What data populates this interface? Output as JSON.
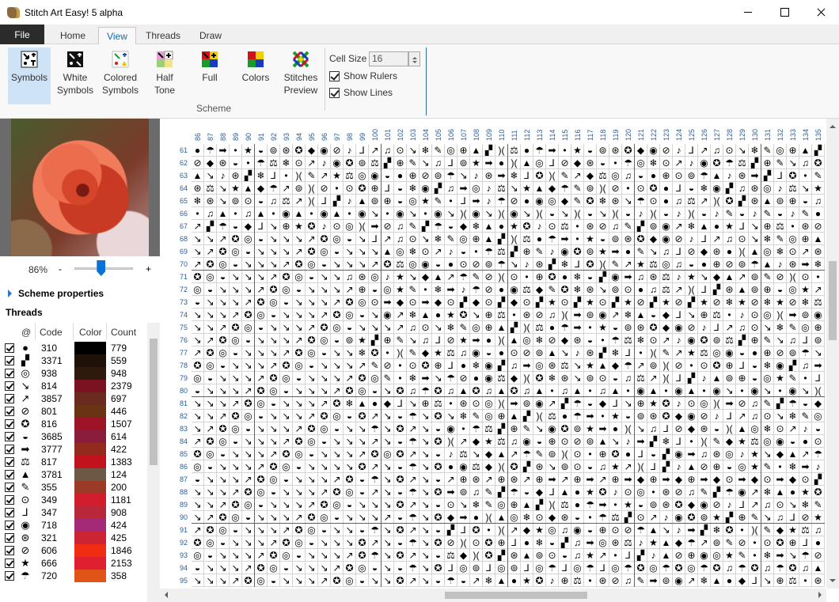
{
  "window": {
    "title": "Stitch Art Easy! 5 alpha"
  },
  "ribbon": {
    "tabs": [
      "File",
      "Home",
      "View",
      "Threads",
      "Draw"
    ],
    "active_tab": "View",
    "buttons": {
      "symbols": "Symbols",
      "white_symbols": "White Symbols",
      "colored_symbols": "Colored Symbols",
      "half_tone": "Half Tone",
      "full": "Full",
      "colors": "Colors",
      "stitches_preview": "Stitches Preview"
    },
    "group_label": "Scheme",
    "cell_size_label": "Cell Size",
    "cell_size_value": "16",
    "show_rulers": "Show Rulers",
    "show_lines": "Show Lines"
  },
  "left_panel": {
    "zoom_value": "86%",
    "zoom_fraction": 0.45,
    "zoom_minus": "-",
    "zoom_plus": "+",
    "scheme_properties": "Scheme properties",
    "threads_label": "Threads",
    "columns": {
      "symbol": "@",
      "code": "Code",
      "color": "Color",
      "count": "Count"
    },
    "threads": [
      {
        "symbol": "●",
        "code": "310",
        "color": "#000000",
        "count": "779"
      },
      {
        "symbol": "▞",
        "code": "3371",
        "color": "#1e1208",
        "count": "559"
      },
      {
        "symbol": "◎",
        "code": "938",
        "color": "#2e1a0c",
        "count": "948"
      },
      {
        "symbol": "↘",
        "code": "814",
        "color": "#7a1222",
        "count": "2379"
      },
      {
        "symbol": "↗",
        "code": "3857",
        "color": "#6a2a20",
        "count": "697"
      },
      {
        "symbol": "⊘",
        "code": "801",
        "color": "#6a3414",
        "count": "446"
      },
      {
        "symbol": "✪",
        "code": "816",
        "color": "#9c1426",
        "count": "1507"
      },
      {
        "symbol": "◒",
        "code": "3685",
        "color": "#8a1c3c",
        "count": "614"
      },
      {
        "symbol": "➡",
        "code": "3777",
        "color": "#922a1e",
        "count": "422"
      },
      {
        "symbol": "⚖",
        "code": "817",
        "color": "#c2121e",
        "count": "1383"
      },
      {
        "symbol": "▲",
        "code": "3781",
        "color": "#6c5844",
        "count": "124"
      },
      {
        "symbol": "✎",
        "code": "355",
        "color": "#9c3a28",
        "count": "200"
      },
      {
        "symbol": "⊙",
        "code": "349",
        "color": "#d21e2c",
        "count": "1181"
      },
      {
        "symbol": "⅃",
        "code": "347",
        "color": "#b8283a",
        "count": "908"
      },
      {
        "symbol": "◉",
        "code": "718",
        "color": "#a42a78",
        "count": "424"
      },
      {
        "symbol": "⊛",
        "code": "321",
        "color": "#cc2432",
        "count": "425"
      },
      {
        "symbol": "⊘",
        "code": "606",
        "color": "#f02c12",
        "count": "1846"
      },
      {
        "symbol": "★",
        "code": "666",
        "color": "#e02030",
        "count": "2153"
      },
      {
        "symbol": "☂",
        "code": "720",
        "color": "#e05418",
        "count": "358"
      }
    ]
  },
  "grid": {
    "col_labels": [
      "86",
      "87",
      "88",
      "89",
      "90",
      "91",
      "92",
      "93",
      "94",
      "95",
      "96",
      "97",
      "98",
      "99",
      "100",
      "101",
      "102",
      "103",
      "104",
      "105",
      "106",
      "107",
      "108",
      "109",
      "110",
      "111",
      "112",
      "113",
      "114",
      "115",
      "116",
      "117",
      "118",
      "119",
      "120",
      "121",
      "122",
      "123",
      "124",
      "125",
      "126",
      "127",
      "128",
      "129",
      "130",
      "131",
      "132",
      "133",
      "134",
      "135"
    ],
    "row_labels": [
      "61",
      "62",
      "63",
      "64",
      "65",
      "66",
      "67",
      "68",
      "69",
      "70",
      "71",
      "72",
      "73",
      "74",
      "75",
      "76",
      "77",
      "78",
      "79",
      "80",
      "81",
      "82",
      "83",
      "84",
      "85",
      "86",
      "87",
      "88",
      "89",
      "90",
      "91",
      "92",
      "93",
      "94",
      "95"
    ],
    "symbols": [
      "●",
      "▞",
      "◎",
      "↘",
      "↗",
      "⊘",
      "✪",
      "◒",
      "➡",
      "⚖",
      "▲",
      "✎",
      "⊙",
      "⅃",
      "◉",
      "⊛",
      "★",
      "☂",
      ")(",
      "⊕",
      "❄",
      "♫",
      "♪",
      "◆",
      "⊚",
      "•"
    ]
  }
}
